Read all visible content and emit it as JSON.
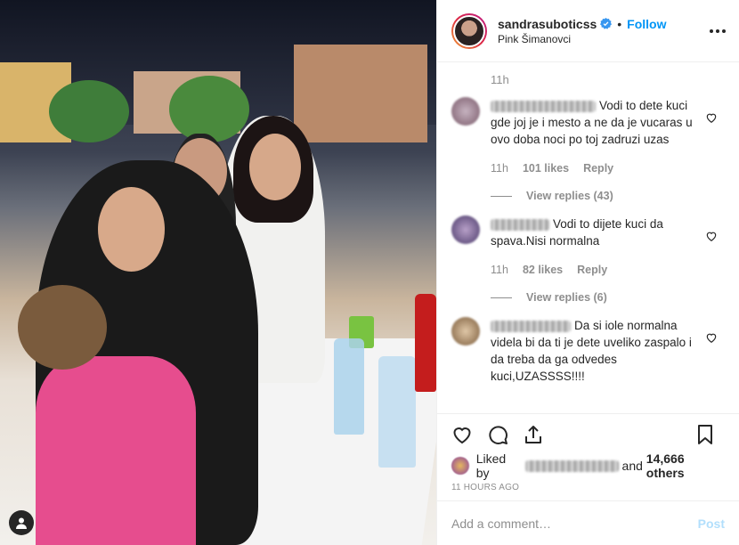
{
  "header": {
    "username": "sandrasuboticss",
    "verified_icon": "verified-badge-icon",
    "separator": "•",
    "follow_label": "Follow",
    "location": "Pink Šimanovci",
    "more_icon": "more-options-icon"
  },
  "comments": {
    "first_time": "11h",
    "items": [
      {
        "text": "Vodi to dete kuci gde joj je i mesto a ne da je vucaras u ovo doba noci po toj zadruzi uzas",
        "time": "11h",
        "likes": "101 likes",
        "reply_label": "Reply",
        "replies": "View replies (43)",
        "avatar_color": "#9a7a88"
      },
      {
        "text": "Vodi to dijete kuci da spava.Nisi normalna",
        "time": "11h",
        "likes": "82 likes",
        "reply_label": "Reply",
        "replies": "View replies (6)",
        "avatar_color": "#6a4a7a"
      },
      {
        "text": "Da si iole normalna videla bi da ti je dete uveliko zaspalo i da treba da ga odvedes kuci,UZASSSS!!!!",
        "avatar_color": "#a88a6a"
      }
    ]
  },
  "actions": {
    "like_icon": "heart-icon",
    "comment_icon": "comment-icon",
    "share_icon": "share-icon",
    "save_icon": "bookmark-icon"
  },
  "likes": {
    "prefix": "Liked by",
    "connector": "and",
    "others": "14,666 others"
  },
  "timestamp": "11 hours ago",
  "add_comment": {
    "placeholder": "Add a comment…",
    "post_label": "Post"
  },
  "colors": {
    "accent": "#0095f6",
    "post_disabled": "#b2dffc",
    "muted": "#8e8e8e"
  }
}
